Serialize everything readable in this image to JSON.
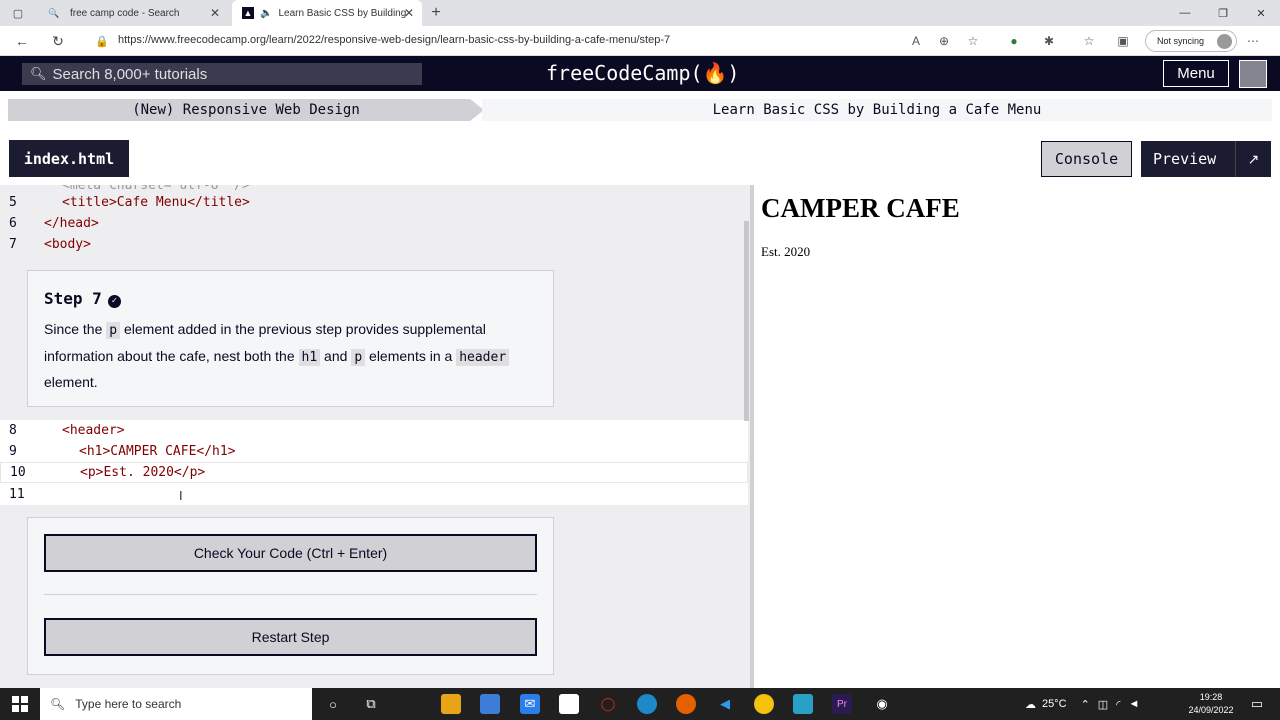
{
  "browser": {
    "tabs": [
      {
        "title": "free camp code - Search",
        "icon": "search-favicon"
      },
      {
        "title": "Learn Basic CSS by Building",
        "icon": "freecodecamp-favicon",
        "audio_icon": "speaker-icon"
      }
    ],
    "url": "https://www.freecodecamp.org/learn/2022/responsive-web-design/learn-basic-css-by-building-a-cafe-menu/step-7",
    "sync_label": "Not syncing"
  },
  "fcc": {
    "search_placeholder": "Search 8,000+ tutorials",
    "logo": "freeCodeCamp(🔥)",
    "menu_label": "Menu",
    "breadcrumb": {
      "course": "(New) Responsive Web Design",
      "project": "Learn Basic CSS by Building a Cafe Menu"
    },
    "file_tab": "index.html",
    "console_label": "Console",
    "preview_label": "Preview"
  },
  "editor": {
    "lines_top": [
      {
        "num": "5",
        "code": "<title>Cafe Menu</title>"
      },
      {
        "num": "6",
        "code": "</head>"
      },
      {
        "num": "7",
        "code": "<body>"
      }
    ],
    "lines_bottom": [
      {
        "num": "8",
        "code": "<header>"
      },
      {
        "num": "9",
        "code": "<h1>CAMPER CAFE</h1>"
      },
      {
        "num": "10",
        "code": "<p>Est. 2020</p>"
      },
      {
        "num": "11",
        "code": ""
      }
    ]
  },
  "step": {
    "title": "Step 7",
    "desc_parts": {
      "p1": "Since the ",
      "c1": "p",
      "p2": " element added in the previous step provides supplemental information about the cafe, nest both the ",
      "c2": "h1",
      "p3": " and ",
      "c3": "p",
      "p4": " elements in a ",
      "c4": "header",
      "p5": " element."
    },
    "check_label": "Check Your Code (Ctrl + Enter)",
    "restart_label": "Restart Step"
  },
  "preview": {
    "h1": "CAMPER CAFE",
    "p": "Est. 2020"
  },
  "taskbar": {
    "search_placeholder": "Type here to search",
    "temperature": "25°C",
    "time": "19:28",
    "date": "24/09/2022"
  },
  "colors": {
    "fcc_dark": "#0a0a23",
    "fcc_gray": "#d0d0d5",
    "tag_color": "#800000"
  }
}
